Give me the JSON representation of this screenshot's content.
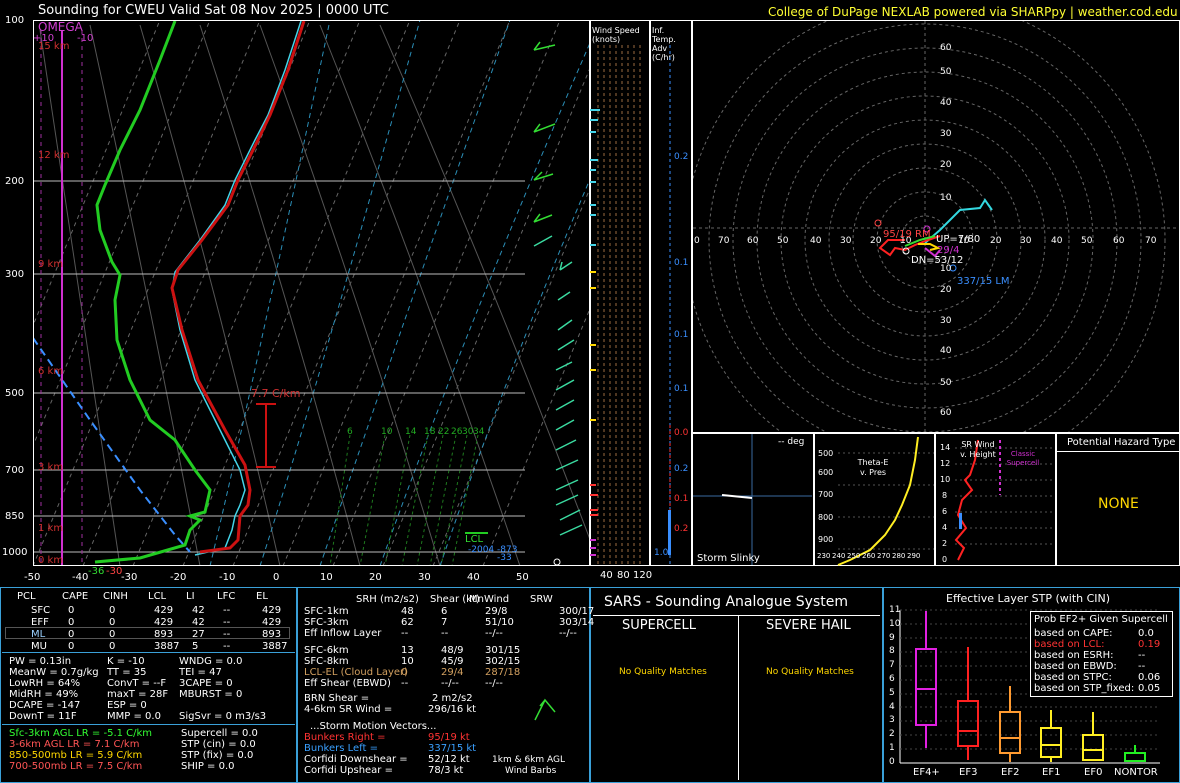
{
  "header": {
    "title": "Sounding for CWEU Valid  Sat 08 Nov 2025 | 0000 UTC",
    "credit": "College of DuPage NEXLAB powered via SHARPpy | weather.cod.edu"
  },
  "skewt": {
    "pressure_labels": [
      "100",
      "200",
      "300",
      "500",
      "700",
      "850",
      "1000"
    ],
    "temp_labels": [
      "-50",
      "-40",
      "-30",
      "-20",
      "-10",
      "0",
      "10",
      "20",
      "30",
      "40",
      "50"
    ],
    "height_labels": [
      "15 km",
      "12 km",
      "9 km",
      "6 km",
      "3 km",
      "1 km",
      "0 km"
    ],
    "omega_title": "OMEGA",
    "omega_ticks": [
      "+10",
      "-10"
    ],
    "lapse_label": "7.7 C/km",
    "mix_ratio_labels": [
      "6",
      "10",
      "14",
      "18",
      "22",
      "26",
      "30",
      "34"
    ],
    "lcl_label": "LCL",
    "sfc_label_a": "-36",
    "sfc_label_b": "-30",
    "bottom_labels": [
      "-2004",
      "-873",
      "-33"
    ]
  },
  "wind_speed": {
    "title": "Wind Speed (knots)",
    "axis": [
      "40",
      "80",
      "120"
    ]
  },
  "temp_adv": {
    "title": "Inf. Temp. Adv (C/hr)",
    "ticks": [
      "0.2",
      "0.1",
      "0.1",
      "0.1",
      "0.2",
      "0.0",
      "0.1",
      "0.2",
      "1.0"
    ]
  },
  "hodograph": {
    "rings_y": [
      "60",
      "50",
      "40",
      "30",
      "20",
      "10",
      "10",
      "20",
      "30",
      "40",
      "50",
      "60"
    ],
    "rings_x": [
      "0",
      "70",
      "60",
      "50",
      "40",
      "30",
      "20",
      "10",
      "10",
      "20",
      "30",
      "40",
      "50",
      "60",
      "70"
    ],
    "rm_label": "95/19 RM",
    "up_label": "UP=7/80",
    "val_label": "29/4",
    "dn_label": "DN=53/12",
    "lm_label": "337/15 LM"
  },
  "slinky": {
    "title": "Storm Slinky",
    "deg": "-- deg"
  },
  "theta": {
    "title": "Theta-E v. Pres",
    "y": [
      "500",
      "600",
      "700",
      "800",
      "900"
    ],
    "x": [
      "230",
      "240",
      "250",
      "260",
      "270",
      "280",
      "290"
    ]
  },
  "srwind": {
    "title": "SR Wind v. Height",
    "y": [
      "14",
      "12",
      "10",
      "8",
      "6",
      "4",
      "2",
      "0"
    ],
    "classic": "Classic Supercell"
  },
  "hazard": {
    "title": "Potential Hazard Type",
    "value": "NONE"
  },
  "parcels": {
    "headers": [
      "PCL",
      "CAPE",
      "CINH",
      "LCL",
      "LI",
      "LFC",
      "EL"
    ],
    "rows": [
      [
        "SFC",
        "0",
        "0",
        "429",
        "42",
        "--",
        "429"
      ],
      [
        "EFF",
        "0",
        "0",
        "429",
        "42",
        "--",
        "429"
      ],
      [
        "ML",
        "0",
        "0",
        "893",
        "27",
        "--",
        "893"
      ],
      [
        "MU",
        "0",
        "0",
        "3887",
        "5",
        "--",
        "3887"
      ]
    ],
    "stats": [
      [
        "PW = 0.13in",
        "K = -10",
        "WNDG = 0.0"
      ],
      [
        "MeanW = 0.7g/kg",
        "TT = 35",
        "TEI = 47"
      ],
      [
        "LowRH = 64%",
        "ConvT = --F",
        "3CAPE = 0"
      ],
      [
        "MidRH = 49%",
        "maxT = 28F",
        "MBURST = 0"
      ],
      [
        "DCAPE = -147",
        "ESP = 0",
        ""
      ],
      [
        "DownT = 11F",
        "MMP = 0.0",
        "SigSvr = 0 m3/s3"
      ]
    ],
    "lapse": [
      {
        "text": "Sfc-3km AGL LR = -5.1 C/km",
        "color": "#33ff33"
      },
      {
        "text": "3-6km AGL LR = 7.1 C/km",
        "color": "#ff5555"
      },
      {
        "text": "850-500mb LR = 5.9 C/km",
        "color": "#ffd700"
      },
      {
        "text": "700-500mb LR = 7.5 C/km",
        "color": "#ff5555"
      }
    ],
    "composite": [
      "Supercell = 0.0",
      "STP (cin) = 0.0",
      "STP (fix) = 0.0",
      "SHIP = 0.0"
    ]
  },
  "kinematics": {
    "headers": [
      "SRH (m2/s2)",
      "Shear (kt)",
      "MnWind",
      "SRW"
    ],
    "rows": [
      [
        "SFC-1km",
        "48",
        "6",
        "29/8",
        "300/17",
        "#ffffff"
      ],
      [
        "SFC-3km",
        "62",
        "7",
        "51/10",
        "303/14",
        "#ffffff"
      ],
      [
        "Eff Inflow Layer",
        "--",
        "--",
        "--/--",
        "--/--",
        "#ffffff"
      ],
      [
        "",
        "",
        "",
        "",
        "",
        ""
      ],
      [
        "SFC-6km",
        "13",
        "48/9",
        "301/15",
        "",
        "#ffffff"
      ],
      [
        "SFC-8km",
        "10",
        "45/9",
        "302/15",
        "",
        "#ffffff"
      ],
      [
        "LCL-EL (Cloud Layer)",
        "0",
        "29/4",
        "287/18",
        "",
        "#d2a060"
      ],
      [
        "Eff Shear (EBWD)",
        "--",
        "--/--",
        "--/--",
        "",
        "#ffffff"
      ]
    ],
    "brn": "BRN Shear =",
    "brn_val": "2 m2/s2",
    "srwind46": "4-6km SR Wind =",
    "srwind46_val": "296/16 kt",
    "storm_motion": "...Storm Motion Vectors...",
    "motions": [
      [
        "Bunkers Right =",
        "95/19 kt",
        "#ff3333"
      ],
      [
        "Bunkers Left =",
        "337/15 kt",
        "#3aa0ff"
      ],
      [
        "Corfidi Downshear =",
        "52/12 kt",
        "#ffffff"
      ],
      [
        "Corfidi Upshear =",
        "78/3 kt",
        "#ffffff"
      ]
    ],
    "barbs_note": [
      "1km & 6km AGL",
      "Wind Barbs"
    ]
  },
  "sars": {
    "title": "SARS - Sounding Analogue System",
    "supercell": "SUPERCELL",
    "hail": "SEVERE HAIL",
    "nomatch": "No Quality Matches"
  },
  "stp": {
    "title": "Effective Layer STP (with CIN)",
    "y": [
      "11",
      "10",
      "9",
      "8",
      "7",
      "6",
      "5",
      "4",
      "3",
      "2",
      "1",
      "0"
    ],
    "cats": [
      "EF4+",
      "EF3",
      "EF2",
      "EF1",
      "EF0",
      "NONTOR"
    ],
    "prob_title": "Prob EF2+ Given Supercell",
    "prob_rows": [
      [
        "based on CAPE:",
        "0.0",
        "#ffffff"
      ],
      [
        "based on LCL:",
        "0.19",
        "#ff3333"
      ],
      [
        "based on ESRH:",
        "--",
        "#ffffff"
      ],
      [
        "based on EBWD:",
        "--",
        "#ffffff"
      ],
      [
        "based on STPC:",
        "0.06",
        "#ffffff"
      ],
      [
        "based on STP_fixed:",
        "0.05",
        "#ffffff"
      ]
    ]
  }
}
